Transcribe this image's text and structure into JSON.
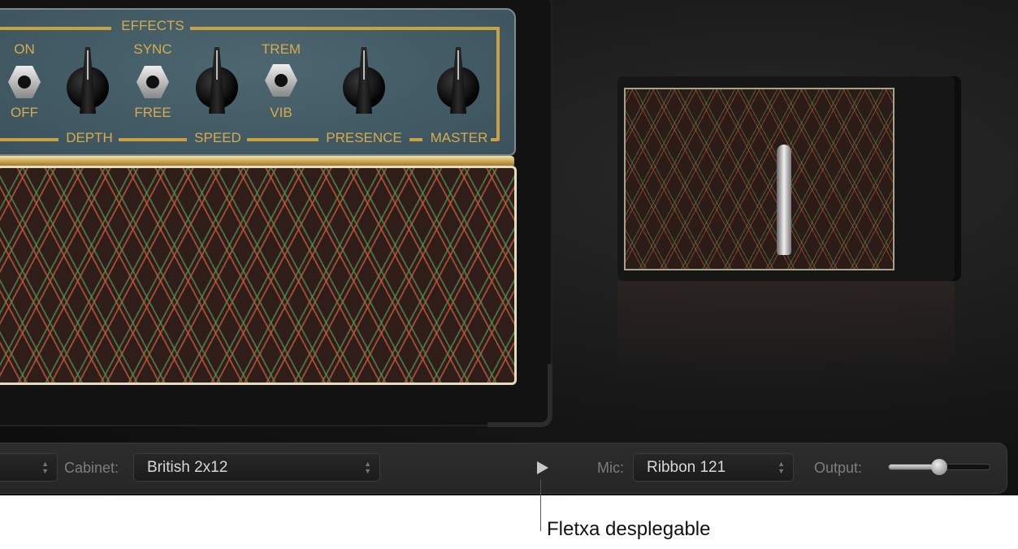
{
  "amp_panel": {
    "section_title": "EFFECTS",
    "toggles": [
      {
        "top": "ON",
        "bottom": "OFF",
        "position": "down"
      },
      {
        "top": "SYNC",
        "bottom": "FREE",
        "position": "down"
      },
      {
        "top": "TREM",
        "bottom": "VIB",
        "position": "up"
      }
    ],
    "knobs": [
      {
        "label": "DEPTH"
      },
      {
        "label": "SPEED"
      },
      {
        "label": "PRESENCE"
      },
      {
        "label": "MASTER"
      }
    ]
  },
  "controls": {
    "cabinet_label": "Cabinet:",
    "cabinet_value": "British 2x12",
    "mic_label": "Mic:",
    "mic_value": "Ribbon 121",
    "output_label": "Output:",
    "output_level": 0.5
  },
  "callout": "Fletxa desplegable",
  "colors": {
    "panel": "#3f5761",
    "gold": "#d6ac4f",
    "bar": "#2a2a2a"
  }
}
